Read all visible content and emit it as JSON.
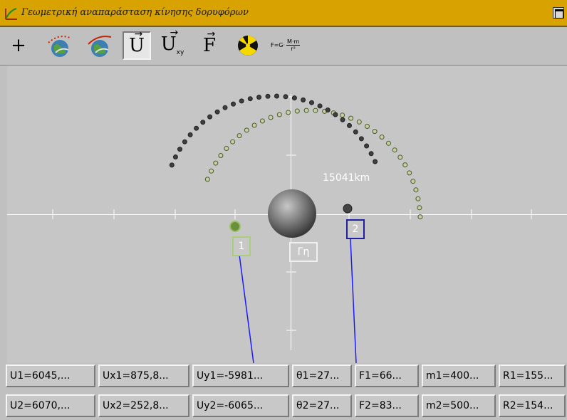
{
  "window": {
    "title": "Γεωμετρική αναπαράσταση κίνησης δορυφόρων"
  },
  "toolbar": {
    "buttons": [
      {
        "name": "add-button",
        "label": "+"
      },
      {
        "name": "earth-orbit-button",
        "icon": "earth-orbit-icon"
      },
      {
        "name": "earth-trajectory-button",
        "icon": "earth-trajectory-icon"
      },
      {
        "name": "velocity-vector-button",
        "label": "U"
      },
      {
        "name": "velocity-components-button",
        "label": "U",
        "sub": "xy"
      },
      {
        "name": "force-vector-button",
        "label": "F"
      },
      {
        "name": "radiation-button",
        "icon": "radiation-icon"
      }
    ],
    "formula": {
      "lhs": "F=G·",
      "num": "M·m",
      "den": "r²"
    }
  },
  "canvas": {
    "earth_label": "Γη",
    "satellite1_label": "1",
    "satellite2_label": "2",
    "distance_label": "15041km",
    "colors": {
      "sat1": "#99c266",
      "sat2": "#2222aa",
      "trail1": "#556b2f",
      "trail2": "#333333",
      "earth": "#777777"
    }
  },
  "status": {
    "row1": [
      "U1=6045,...",
      "Ux1=875,8...",
      "Uy1=-5981...",
      "θ1=27...",
      "F1=66...",
      "m1=400...",
      "R1=155..."
    ],
    "row2": [
      "U2=6070,...",
      "Ux2=252,8...",
      "Uy2=-6065...",
      "θ2=27...",
      "F2=83...",
      "m2=500...",
      "R2=154..."
    ]
  }
}
